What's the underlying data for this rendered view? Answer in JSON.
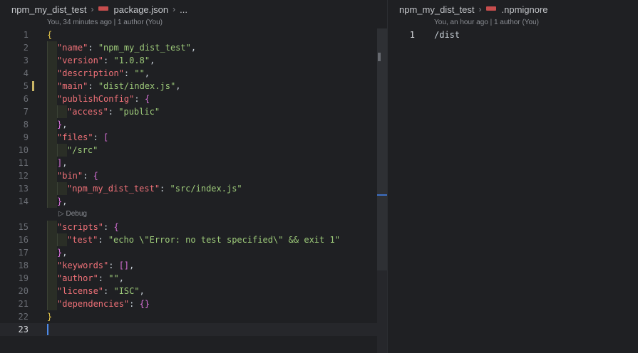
{
  "left": {
    "breadcrumb": {
      "folder": "npm_my_dist_test",
      "file": "package.json",
      "more": "..."
    },
    "blame": "You, 34 minutes ago | 1 author (You)",
    "codelens": "▷ Debug",
    "lines": {
      "l1": "1",
      "l2": "2",
      "l3": "3",
      "l4": "4",
      "l5": "5",
      "l6": "6",
      "l7": "7",
      "l8": "8",
      "l9": "9",
      "l10": "10",
      "l11": "11",
      "l12": "12",
      "l13": "13",
      "l14": "14",
      "l15": "15",
      "l16": "16",
      "l17": "17",
      "l18": "18",
      "l19": "19",
      "l20": "20",
      "l21": "21",
      "l22": "22",
      "l23": "23"
    },
    "code": {
      "k_name": "\"name\"",
      "v_name": "\"npm_my_dist_test\"",
      "k_version": "\"version\"",
      "v_version": "\"1.0.8\"",
      "k_description": "\"description\"",
      "v_description": "\"\"",
      "k_main": "\"main\"",
      "v_main": "\"dist/index.js\"",
      "k_publish": "\"publishConfig\"",
      "k_access": "\"access\"",
      "v_access": "\"public\"",
      "k_files": "\"files\"",
      "v_src": "\"/src\"",
      "k_bin": "\"bin\"",
      "k_binname": "\"npm_my_dist_test\"",
      "v_binpath": "\"src/index.js\"",
      "k_scripts": "\"scripts\"",
      "k_test": "\"test\"",
      "v_test": "\"echo \\\"Error: no test specified\\\" && exit 1\"",
      "k_keywords": "\"keywords\"",
      "k_author": "\"author\"",
      "v_author": "\"\"",
      "k_license": "\"license\"",
      "v_license": "\"ISC\"",
      "k_deps": "\"dependencies\""
    }
  },
  "right": {
    "breadcrumb": {
      "folder": "npm_my_dist_test",
      "file": ".npmignore"
    },
    "blame": "You, an hour ago | 1 author (You)",
    "line_number": "1",
    "content": "/dist"
  }
}
